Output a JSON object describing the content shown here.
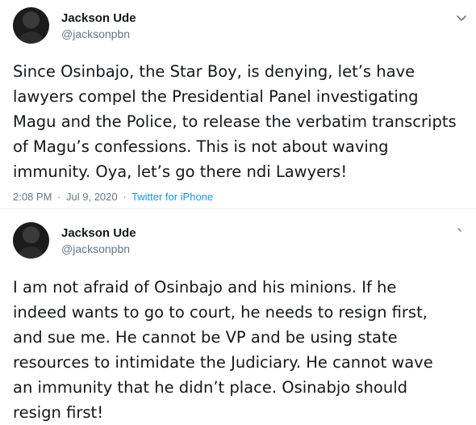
{
  "tweets": [
    {
      "author": {
        "name": "Jackson Ude",
        "handle": "@jacksonpbn"
      },
      "text_lines": [
        "Since Osinbajo, the Star Boy, is denying, let’s have",
        "lawyers compel the Presidential Panel investigating",
        "Magu and the Police, to release the verbatim transcripts",
        "of Magu’s confessions. This is not about waving",
        "immunity. Oya, let’s go there ndi Lawyers!"
      ],
      "time": "2:08 PM",
      "date": "Jul 9, 2020",
      "separator": "·",
      "source": "Twitter for iPhone",
      "menu_icon": "chevron-down-icon"
    },
    {
      "author": {
        "name": "Jackson Ude",
        "handle": "@jacksonpbn"
      },
      "text_lines": [
        "I am not afraid of Osinbajo and his minions. If he",
        "indeed wants to go to court, he needs to resign first,",
        "and sue me. He cannot be VP and be using state",
        "resources to intimidate the Judiciary. He cannot wave",
        "an immunity that he didn’t place. Osinabjo should",
        "resign first!"
      ],
      "menu_icon": "chevron-down-icon"
    }
  ],
  "colors": {
    "text": "#14171a",
    "secondary": "#657786",
    "link": "#1b95e0",
    "divider": "#e6ecf0"
  }
}
